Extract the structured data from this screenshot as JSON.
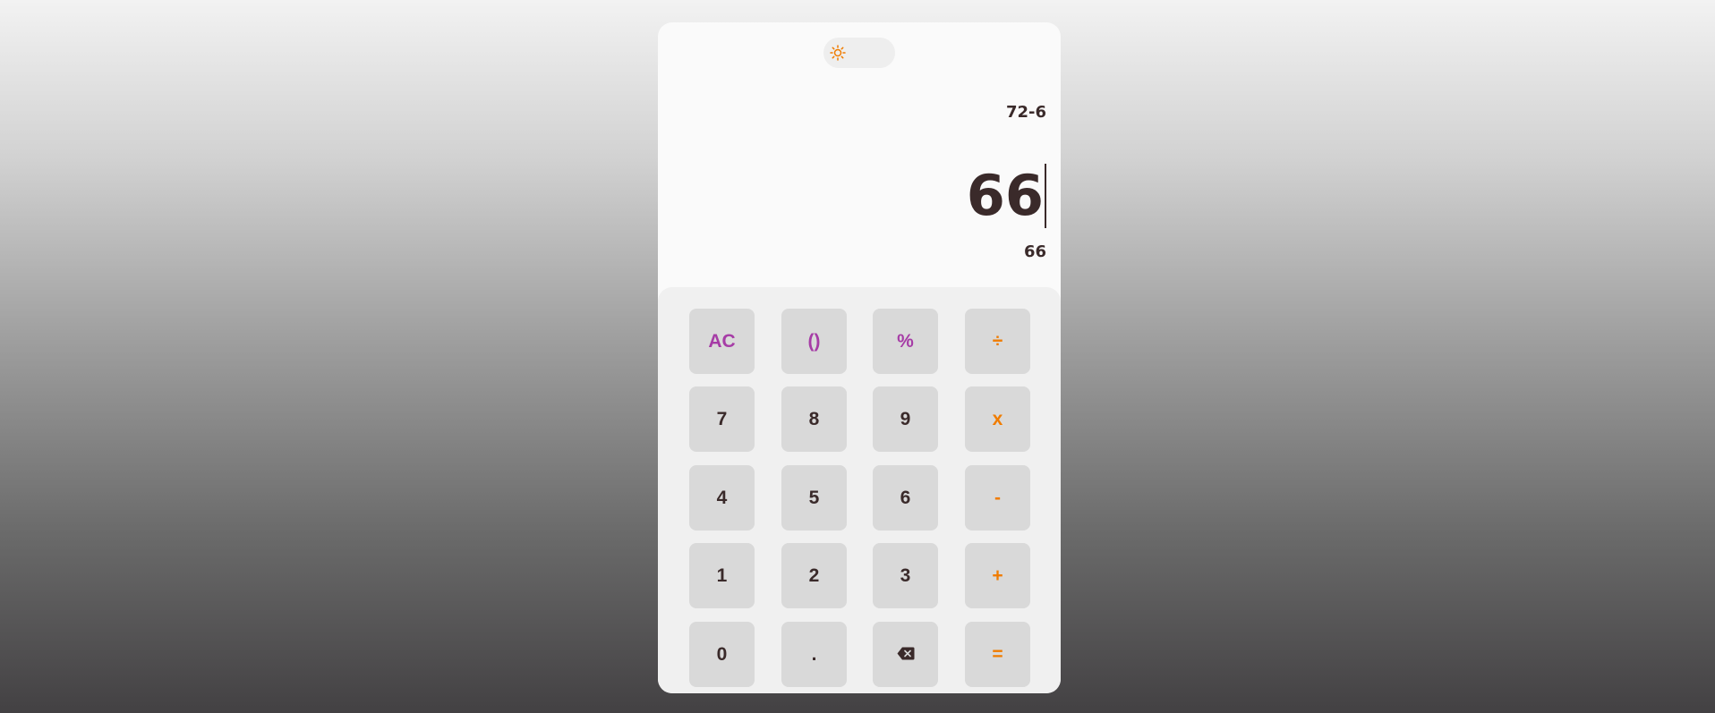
{
  "theme_toggle": {
    "icon": "sun-icon"
  },
  "display": {
    "expression": "72-6",
    "current": "66",
    "result": "66"
  },
  "keypad": {
    "rows": [
      [
        "AC",
        "()",
        "%",
        "÷"
      ],
      [
        "7",
        "8",
        "9",
        "x"
      ],
      [
        "4",
        "5",
        "6",
        "-"
      ],
      [
        "1",
        "2",
        "3",
        "+"
      ],
      [
        "0",
        ".",
        "backspace-icon",
        "="
      ]
    ]
  },
  "colors": {
    "accent_orange": "#f07c00",
    "accent_purple": "#a63ca6",
    "text": "#3a2a2a",
    "key_bg": "#d9d9d9"
  }
}
